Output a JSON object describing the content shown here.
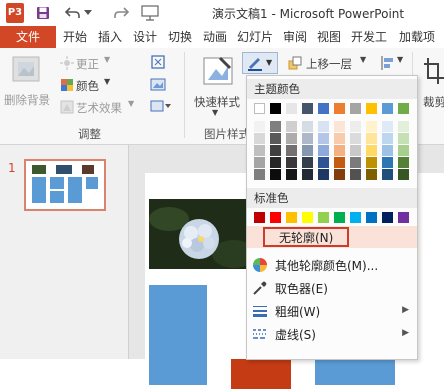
{
  "window": {
    "title": "演示文稿1 - Microsoft PowerPoint",
    "logo": "P3"
  },
  "tabs": [
    "文件",
    "开始",
    "插入",
    "设计",
    "切换",
    "动画",
    "幻灯片",
    "审阅",
    "视图",
    "开发工",
    "加载项"
  ],
  "ribbon": {
    "adjust": {
      "remove_bg": "删除背景",
      "corrections": "更正",
      "color": "颜色",
      "artistic": "艺术效果",
      "group_label": "调整"
    },
    "picture_styles": {
      "quick_styles": "快速样式",
      "group_label": "图片样式"
    },
    "arrange": {
      "bring_forward": "上移一层"
    },
    "size": {
      "crop": "裁剪"
    }
  },
  "thumbnails": [
    {
      "number": "1"
    }
  ],
  "outline_menu": {
    "theme_colors_header": "主题颜色",
    "standard_colors_header": "标准色",
    "theme_colors": [
      [
        "#ffffff",
        "#000000",
        "#e7e6e6",
        "#44546a",
        "#4472c4",
        "#ed7d31",
        "#a5a5a5",
        "#ffc000",
        "#5b9bd5",
        "#70ad47"
      ],
      [
        "#f2f2f2",
        "#7f7f7f",
        "#d0cece",
        "#d6dce4",
        "#d9e2f3",
        "#fbe5d5",
        "#ededed",
        "#fff2cc",
        "#deebf6",
        "#e2efd9"
      ],
      [
        "#d8d8d8",
        "#595959",
        "#aeabab",
        "#adb9ca",
        "#b4c6e7",
        "#f7cbac",
        "#dbdbdb",
        "#fee599",
        "#bdd7ee",
        "#c5e0b3"
      ],
      [
        "#bfbfbf",
        "#3f3f3f",
        "#757070",
        "#8496b0",
        "#8eaadb",
        "#f4b183",
        "#c9c9c9",
        "#ffd965",
        "#9cc3e5",
        "#a8d08d"
      ],
      [
        "#a5a5a5",
        "#262626",
        "#3a3838",
        "#323f4f",
        "#2f5496",
        "#c55a11",
        "#7b7b7b",
        "#bf9000",
        "#2e75b5",
        "#538135"
      ],
      [
        "#7f7f7f",
        "#0c0c0c",
        "#171616",
        "#222a35",
        "#1f3864",
        "#833c0b",
        "#525252",
        "#7f6000",
        "#1e4e79",
        "#375623"
      ]
    ],
    "standard_colors": [
      "#c00000",
      "#ff0000",
      "#ffc000",
      "#ffff00",
      "#92d050",
      "#00b050",
      "#00b0f0",
      "#0070c0",
      "#002060",
      "#7030a0"
    ],
    "items": {
      "no_outline": "无轮廓(N)",
      "more_colors": "其他轮廓颜色(M)...",
      "eyedropper": "取色器(E)",
      "weight": "粗细(W)",
      "dashes": "虚线(S)"
    }
  }
}
